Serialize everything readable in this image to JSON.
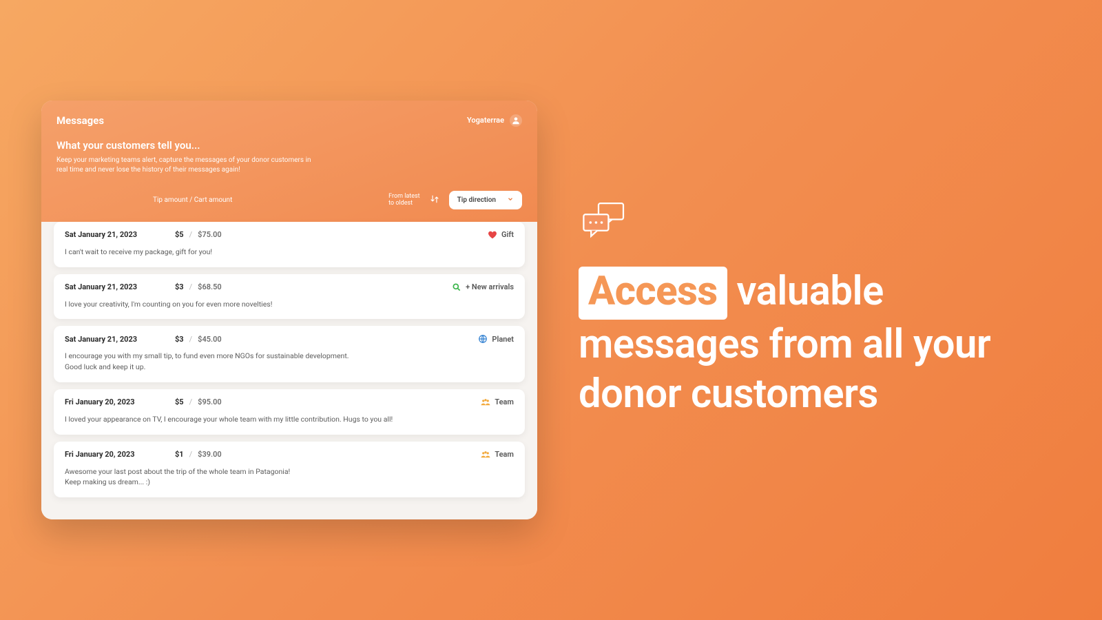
{
  "header": {
    "title": "Messages",
    "user": "Yogaterrae"
  },
  "intro": {
    "subtitle": "What your customers tell you...",
    "description": "Keep your marketing teams alert, capture the messages of your donor customers in real time and never lose the history of their messages again!"
  },
  "controls": {
    "columns_label": "Tip amount / Cart amount",
    "sort_label_l1": "From latest",
    "sort_label_l2": "to oldest",
    "tip_button": "Tip direction"
  },
  "items": [
    {
      "date": "Sat January 21, 2023",
      "tip": "$5",
      "cart": "$75.00",
      "tag": "Gift",
      "tag_icon": "heart",
      "body": "I can't wait to receive my package, gift for you!"
    },
    {
      "date": "Sat January 21, 2023",
      "tip": "$3",
      "cart": "$68.50",
      "tag": "+ New arrivals",
      "tag_icon": "search",
      "body": "I love your creativity, I'm counting on you for even more novelties!"
    },
    {
      "date": "Sat January 21, 2023",
      "tip": "$3",
      "cart": "$45.00",
      "tag": "Planet",
      "tag_icon": "globe",
      "body": "I encourage you with my small tip, to fund even more NGOs for sustainable development.\nGood luck and keep it up."
    },
    {
      "date": "Fri January 20, 2023",
      "tip": "$5",
      "cart": "$95.00",
      "tag": "Team",
      "tag_icon": "team",
      "body": "I loved your appearance on TV, I encourage your whole team with my little contribution. Hugs to you all!"
    },
    {
      "date": "Fri January 20, 2023",
      "tip": "$1",
      "cart": "$39.00",
      "tag": "Team",
      "tag_icon": "team",
      "body": "Awesome your last post about the trip of the whole team in Patagonia!\nKeep making us dream... :)"
    }
  ],
  "promo": {
    "highlight": "Access",
    "rest": " valuable messages from all your donor customers"
  }
}
